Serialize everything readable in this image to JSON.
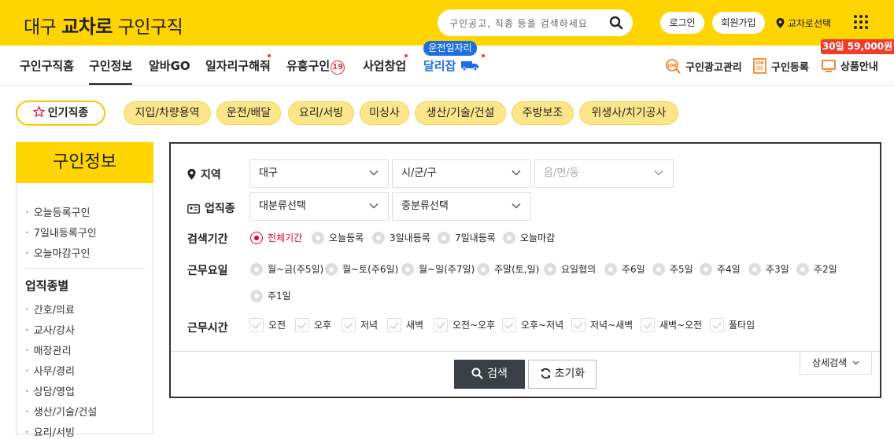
{
  "header": {
    "logo_prefix": "대구",
    "logo_bold": "교차로",
    "logo_suffix": "구인구직",
    "search_placeholder": "구인공고, 직종 등을 검색하세요",
    "login": "로그인",
    "signup": "회원가입",
    "region_select": "교차로선택"
  },
  "nav": {
    "items": [
      "구인구직홈",
      "구인정보",
      "알바GO",
      "일자리구해줘",
      "유흥구인",
      "사업창업",
      "달리잡"
    ],
    "adult_badge": "19",
    "tooltip": "운전일자리",
    "right": [
      "구인광고관리",
      "구인등록",
      "상품안내"
    ],
    "promo": "30일 59,000원"
  },
  "popular": {
    "label": "인기직종",
    "chips": [
      "지입/차량용역",
      "운전/배달",
      "요리/서빙",
      "미싱사",
      "생산/기술/건설",
      "주방보조",
      "위생사/치기공사"
    ]
  },
  "sidebar": {
    "title": "구인정보",
    "links": [
      "오늘등록구인",
      "7일내등록구인",
      "오늘마감구인"
    ],
    "category_title": "업직종별",
    "categories": [
      "간호/의료",
      "교사/강사",
      "매장관리",
      "사무/경리",
      "상담/영업",
      "생산/기술/건설",
      "요리/서빙"
    ]
  },
  "filters": {
    "region": {
      "label": "지역",
      "province": "대구",
      "district": "시/군/구",
      "town": "읍/면/동"
    },
    "job": {
      "label": "업직종",
      "major": "대분류선택",
      "minor": "중분류선택"
    },
    "period": {
      "label": "검색기간",
      "options": [
        "전체기간",
        "오늘등록",
        "3일내등록",
        "7일내등록",
        "오늘마감"
      ],
      "selected": "전체기간"
    },
    "workdays": {
      "label": "근무요일",
      "options": [
        "월~금(주5일)",
        "월~토(주6일)",
        "월~일(주7일)",
        "주말(토,일)",
        "요일협의",
        "주6일",
        "주5일",
        "주4일",
        "주3일",
        "주2일",
        "주1일"
      ]
    },
    "worktime": {
      "label": "근무시간",
      "options": [
        "오전",
        "오후",
        "저녁",
        "새벽",
        "오전~오후",
        "오후~저녁",
        "저녁~새벽",
        "새벽~오전",
        "풀타임"
      ]
    },
    "search_button": "검색",
    "reset_button": "초기화",
    "detail_button": "상세검색"
  },
  "colors": {
    "brand_yellow": "#ffd400",
    "chip_bg": "#fde68a",
    "selected_red": "#e5002b",
    "accent_blue": "#1f6fe0",
    "promo_red": "#f03c2e"
  }
}
